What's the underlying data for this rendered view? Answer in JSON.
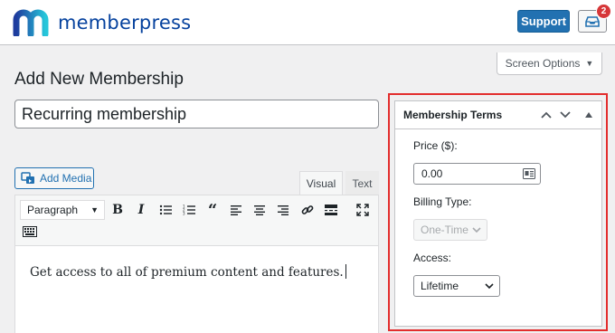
{
  "header": {
    "brand_name": "memberpress",
    "support_label": "Support",
    "notification_count": "2",
    "brand_color": "#06429e"
  },
  "screen_options": {
    "label": "Screen Options"
  },
  "page": {
    "title": "Add New Membership",
    "post_title_value": "Recurring membership"
  },
  "editor": {
    "add_media_label": "Add Media",
    "tabs": {
      "visual": "Visual",
      "text": "Text"
    },
    "format_select_value": "Paragraph",
    "toolbar_icons": [
      "bold-icon",
      "italic-icon",
      "bulleted-list-icon",
      "numbered-list-icon",
      "blockquote-icon",
      "align-left-icon",
      "align-center-icon",
      "align-right-icon",
      "link-icon",
      "read-more-icon",
      "fullscreen-icon",
      "toolbar-toggle-icon"
    ],
    "content": "Get access to all of premium content and features."
  },
  "membership_terms": {
    "title": "Membership Terms",
    "price_label": "Price ($):",
    "price_value": "0.00",
    "billing_type_label": "Billing Type:",
    "billing_type_value": "One-Time",
    "access_label": "Access:",
    "access_value": "Lifetime",
    "highlight_color": "#e32d2d"
  }
}
